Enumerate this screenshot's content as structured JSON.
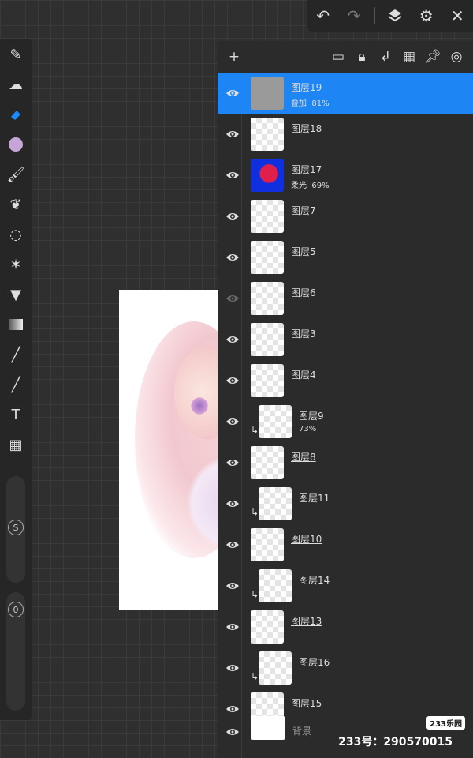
{
  "topbar": {
    "icons": [
      "undo-icon",
      "redo-icon",
      "layers-icon",
      "gear-icon",
      "close-icon"
    ]
  },
  "toolbar": {
    "tools": [
      "pen-icon",
      "smudge-icon",
      "eraser-icon",
      "color-icon",
      "brush-icon",
      "leaf-icon",
      "lasso-icon",
      "magic-wand-icon",
      "fill-bucket-icon",
      "gradient-icon",
      "eyedropper-icon",
      "line-icon",
      "text-icon",
      "grid-icon"
    ],
    "active_tool": "eraser-icon",
    "color": "#c8a5d8",
    "size_label": "S",
    "opacity_label": "0"
  },
  "panel": {
    "icons": [
      "add-layer-icon",
      "folder-icon",
      "lock-icon",
      "clip-icon",
      "alpha-icon",
      "pin-icon",
      "settings-icon"
    ],
    "layers": [
      {
        "name": "图层19",
        "mode": "叠加",
        "opacity": "81%",
        "active": true,
        "visible": true
      },
      {
        "name": "图层18",
        "visible": true
      },
      {
        "name": "图层17",
        "mode": "柔光",
        "opacity": "69%",
        "visible": true
      },
      {
        "name": "图层7",
        "visible": true
      },
      {
        "name": "图层5",
        "visible": true
      },
      {
        "name": "图层6",
        "visible": false
      },
      {
        "name": "图层3",
        "visible": true
      },
      {
        "name": "图层4",
        "visible": true
      },
      {
        "name": "图层9",
        "opacity": "73%",
        "clipped": true,
        "visible": true
      },
      {
        "name": "图层8",
        "underline": true,
        "visible": true
      },
      {
        "name": "图层11",
        "clipped": true,
        "visible": true
      },
      {
        "name": "图层10",
        "underline": true,
        "visible": true
      },
      {
        "name": "图层14",
        "clipped": true,
        "visible": true
      },
      {
        "name": "图层13",
        "underline": true,
        "visible": true
      },
      {
        "name": "图层16",
        "clipped": true,
        "visible": true
      },
      {
        "name": "图层15",
        "visible": true
      }
    ],
    "background_label": "背景"
  },
  "watermark": {
    "badge": "233乐园",
    "id_text": "233号：290570015"
  }
}
